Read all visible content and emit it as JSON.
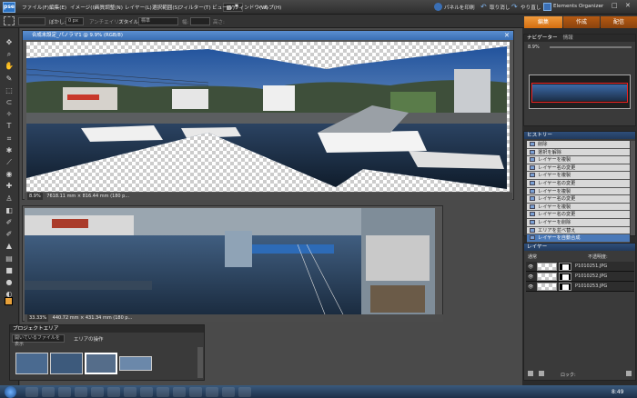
{
  "app": {
    "logo_text": "pse"
  },
  "menu": [
    "ファイル(F)",
    "編集(E)",
    "イメージ(I)",
    "画質調整(N)",
    "レイヤー(L)",
    "選択範囲(S)",
    "フィルター(T)",
    "ビュー(V)",
    "ウィンドウ(W)",
    "ヘルプ(H)"
  ],
  "header_right": {
    "panorama": "パネルを印刷",
    "undo": "取り消し",
    "redo": "やり直し",
    "organizer": "Elements Organizer"
  },
  "options": {
    "feather_label": "ぼかし:",
    "feather_value": "0 px",
    "antialias": "アンチエイリアス",
    "style_label": "スタイル:",
    "style_value": "標準",
    "width_label": "幅:",
    "height_label": "高さ:"
  },
  "mode_tabs": {
    "edit": "編集",
    "create": "作成",
    "share": "配信"
  },
  "doc1": {
    "title": "合成未設定_パノラマ1 @ 9.9% (RGB/8)",
    "zoom": "8.9%",
    "status": "7618.11 mm × 816.44 mm (180 p..."
  },
  "doc2": {
    "zoom": "33.33%",
    "status": "440.72 mm × 431.34 mm (180 p..."
  },
  "project_bin": {
    "title": "プロジェクトエリア",
    "filter": "開いているファイルを表示",
    "action": "エリアの操作"
  },
  "navigator": {
    "title": "ナビゲーター",
    "tab2": "情報",
    "zoom": "8.9%"
  },
  "history": {
    "title": "ヒストリー",
    "items": [
      "削除",
      "選択を解除",
      "レイヤーを複製",
      "レイヤー名の変更",
      "レイヤーを複製",
      "レイヤー名の変更",
      "レイヤーを複製",
      "レイヤー名の変更",
      "レイヤーを複製",
      "レイヤー名の変更",
      "レイヤーを削除",
      "エリアを並べ替え",
      "レイヤーを自動合成"
    ]
  },
  "layers": {
    "title": "レイヤー",
    "mode": "通常",
    "opacity": "不透明度:",
    "lock": "ロック:",
    "rows": [
      "P1010251.JPG",
      "P1010252.JPG",
      "P1010253.JPG"
    ]
  },
  "taskbar": {
    "time": "8:49"
  },
  "colors": {
    "accent_orange": "#e87e1a",
    "tab_green": "#4e9a3a",
    "tab_orange": "#c46a12",
    "panel_blue": "#2e4e7a"
  }
}
